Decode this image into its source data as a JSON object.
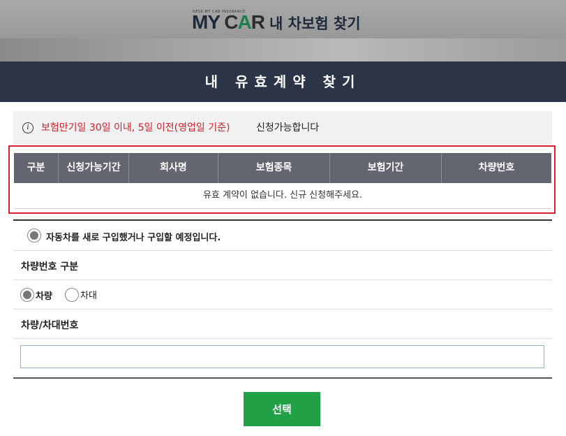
{
  "background": {
    "logo_tagline": "DESK MY CAR INSURANCE",
    "logo_my": "MY",
    "logo_car_c": "C",
    "logo_car_a": "A",
    "logo_car_r": "R",
    "logo_subtitle": "내 차보험 찾기"
  },
  "modal": {
    "title": "내 유효계약 찾기",
    "notice": {
      "icon": "info-icon",
      "highlight": "보험만기일 30일 이내, 5일 이전(영업일 기준)",
      "rest": "신청가능합니다"
    },
    "table": {
      "headers": [
        "구분",
        "신청가능기간",
        "회사명",
        "보험종목",
        "보험기간",
        "차량번호"
      ],
      "empty_message": "유효 계약이 없습니다. 신규 신청해주세요."
    },
    "purchase_option": "자동차를 새로 구입했거나 구입할 예정입니다.",
    "vehicle_type_label": "차량번호 구분",
    "vehicle_type_options": [
      "차량",
      "차대"
    ],
    "vehicle_number_label": "차량/차대번호",
    "vehicle_number_value": "",
    "select_button": "선택"
  },
  "colors": {
    "header_bg": "#2c3548",
    "notice_highlight": "#d21f2a",
    "table_header": "#636670",
    "table_highlight_border": "#d9202c",
    "button": "#22a045"
  }
}
